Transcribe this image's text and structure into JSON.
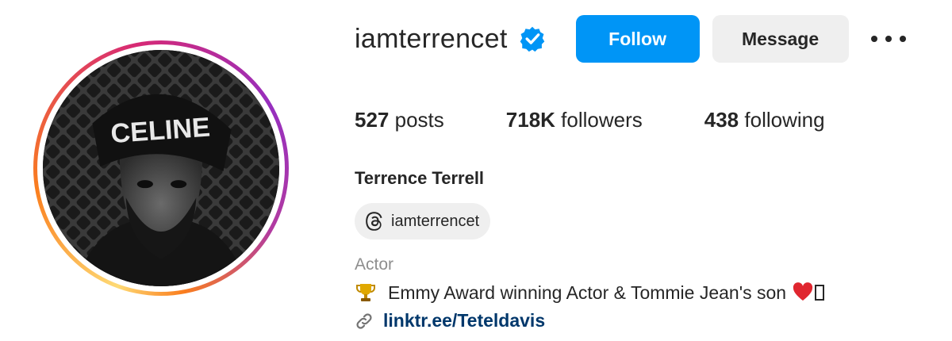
{
  "profile": {
    "username": "iamterrencet",
    "verified_icon": "verified-badge-icon",
    "follow_label": "Follow",
    "message_label": "Message",
    "more_icon": "more-options-icon",
    "posts_count": "527",
    "posts_label": "posts",
    "followers_count": "718K",
    "followers_label": "followers",
    "following_count": "438",
    "following_label": "following",
    "full_name": "Terrence Terrell",
    "threads_handle": "iamterrencet",
    "category": "Actor",
    "bio": "Emmy Award winning Actor & Tommie Jean's son",
    "link": "linktr.ee/Teteldavis",
    "avatar_text": "CELINE"
  },
  "colors": {
    "accent": "#0095f6",
    "secondary_button": "#efefef",
    "text": "#262626",
    "muted": "#8e8e8e",
    "link": "#00376b"
  }
}
